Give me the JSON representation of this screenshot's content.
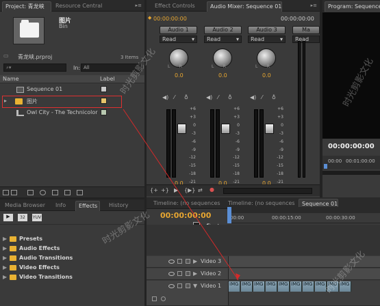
{
  "project": {
    "tab_active": "Project: 青龙峡",
    "tab_other": "Resource Central",
    "preview_name": "图片",
    "preview_type": "Bin",
    "file_name": "青龙峡.prproj",
    "items_count": "3 Items",
    "search_placeholder": "",
    "in_label": "In:",
    "in_value": "All",
    "col_name": "Name",
    "col_label": "Label",
    "items": [
      {
        "name": "Sequence 01",
        "label_color": "#c8c8c8",
        "icon": "sequence-icon"
      },
      {
        "name": "图片",
        "label_color": "#e8c46a",
        "icon": "folder-icon"
      },
      {
        "name": "Owl City - The Technicolor",
        "label_color": "#b8c8b0",
        "icon": "audio-clip-icon"
      }
    ]
  },
  "mixer": {
    "tab_effect_controls": "Effect Controls",
    "tab_audio_mixer": "Audio Mixer: Sequence 01",
    "timecode_left": "00:00:00:00",
    "timecode_right": "00:00:00:00",
    "channels": [
      {
        "name": "Audio 1",
        "mode": "Read",
        "pan": "0.0",
        "level": "0.0"
      },
      {
        "name": "Audio 2",
        "mode": "Read",
        "pan": "0.0",
        "level": "0.0"
      },
      {
        "name": "Audio 3",
        "mode": "Read",
        "pan": "0.0",
        "level": "0.0"
      },
      {
        "name": "Ma",
        "mode": "Read",
        "pan": "",
        "level": ""
      }
    ],
    "scale": [
      "+6",
      "+3",
      "0",
      "-3",
      "-6",
      "-9",
      "-12",
      "-15",
      "-18",
      "-21",
      "-30",
      "-∞"
    ]
  },
  "program": {
    "tab": "Program: Sequence",
    "timecode": "00:00:00:00",
    "ruler_start": "00:00",
    "ruler_mid": "00:01:00:00"
  },
  "effects": {
    "tabs": [
      "Media Browser",
      "Info",
      "Effects",
      "History"
    ],
    "categories": [
      "Presets",
      "Audio Effects",
      "Audio Transitions",
      "Video Effects",
      "Video Transitions"
    ]
  },
  "timeline": {
    "tabs": [
      "Timeline: (no sequences)",
      "Timeline: (no sequences)",
      "Sequence 01"
    ],
    "timecode": "00:00:00:00",
    "ruler_labels": [
      "00:00",
      "00:00:15:00",
      "00:00:30:00"
    ],
    "tracks": [
      "Video 3",
      "Video 2",
      "Video 1"
    ],
    "clip_label": "IMG"
  },
  "watermark": "时光剪影文化"
}
